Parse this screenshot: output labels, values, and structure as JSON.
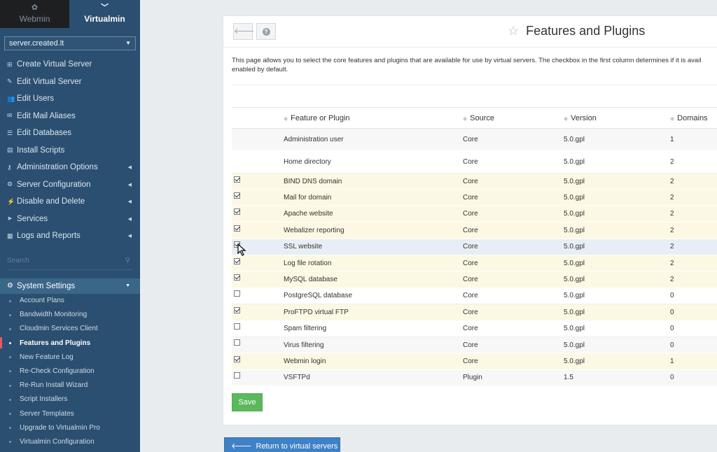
{
  "switcher": {
    "webmin": "Webmin",
    "virtualmin": "Virtualmin"
  },
  "server_select": {
    "value": "server.created.lt"
  },
  "menu": [
    {
      "label": "Create Virtual Server",
      "icon": "plus-square-icon",
      "has_submenu": false
    },
    {
      "label": "Edit Virtual Server",
      "icon": "edit-icon",
      "has_submenu": false
    },
    {
      "label": "Edit Users",
      "icon": "users-icon",
      "has_submenu": false
    },
    {
      "label": "Edit Mail Aliases",
      "icon": "envelope-icon",
      "has_submenu": false
    },
    {
      "label": "Edit Databases",
      "icon": "database-icon",
      "has_submenu": false
    },
    {
      "label": "Install Scripts",
      "icon": "archive-icon",
      "has_submenu": false
    },
    {
      "label": "Administration Options",
      "icon": "key-icon",
      "has_submenu": true
    },
    {
      "label": "Server Configuration",
      "icon": "cogs-icon",
      "has_submenu": true
    },
    {
      "label": "Disable and Delete",
      "icon": "plug-icon",
      "has_submenu": true
    },
    {
      "label": "Services",
      "icon": "paper-plane-icon",
      "has_submenu": true
    },
    {
      "label": "Logs and Reports",
      "icon": "file-icon",
      "has_submenu": true
    }
  ],
  "sidebar_search": {
    "placeholder": "Search"
  },
  "system_settings": {
    "label": "System Settings",
    "items": [
      {
        "label": "Account Plans",
        "active": false
      },
      {
        "label": "Bandwidth Monitoring",
        "active": false
      },
      {
        "label": "Cloudmin Services Client",
        "active": false
      },
      {
        "label": "Features and Plugins",
        "active": true
      },
      {
        "label": "New Feature Log",
        "active": false
      },
      {
        "label": "Re-Check Configuration",
        "active": false
      },
      {
        "label": "Re-Run Install Wizard",
        "active": false
      },
      {
        "label": "Script Installers",
        "active": false
      },
      {
        "label": "Server Templates",
        "active": false
      },
      {
        "label": "Upgrade to Virtualmin Pro",
        "active": false
      },
      {
        "label": "Virtualmin Configuration",
        "active": false
      }
    ]
  },
  "page": {
    "title": "Features and Plugins",
    "description_line1": "This page allows you to select the core features and plugins that are available for use by virtual servers. The checkbox in the first column determines if it is avail",
    "description_line2": "enabled by default."
  },
  "table": {
    "columns": {
      "name": "Feature or Plugin",
      "source": "Source",
      "version": "Version",
      "domains": "Domains"
    },
    "rows": [
      {
        "checkbox": "none",
        "name": "Administration user",
        "source": "Core",
        "version": "5.0.gpl",
        "domains": "1",
        "bg": "grey",
        "tall": true
      },
      {
        "checkbox": "none",
        "name": "Home directory",
        "source": "Core",
        "version": "5.0.gpl",
        "domains": "2",
        "bg": "white",
        "tall": true
      },
      {
        "checkbox": "checked",
        "name": "BIND DNS domain",
        "source": "Core",
        "version": "5.0.gpl",
        "domains": "2",
        "bg": "yellow"
      },
      {
        "checkbox": "checked",
        "name": "Mail for domain",
        "source": "Core",
        "version": "5.0.gpl",
        "domains": "2",
        "bg": "yellow"
      },
      {
        "checkbox": "checked",
        "name": "Apache website",
        "source": "Core",
        "version": "5.0.gpl",
        "domains": "2",
        "bg": "yellow"
      },
      {
        "checkbox": "checked",
        "name": "Webalizer reporting",
        "source": "Core",
        "version": "5.0.gpl",
        "domains": "2",
        "bg": "yellow"
      },
      {
        "checkbox": "checked",
        "name": "SSL website",
        "source": "Core",
        "version": "5.0.gpl",
        "domains": "2",
        "bg": "blue"
      },
      {
        "checkbox": "checked",
        "name": "Log file rotation",
        "source": "Core",
        "version": "5.0.gpl",
        "domains": "2",
        "bg": "yellow"
      },
      {
        "checkbox": "checked",
        "name": "MySQL database",
        "source": "Core",
        "version": "5.0.gpl",
        "domains": "2",
        "bg": "yellow"
      },
      {
        "checkbox": "unchecked",
        "name": "PostgreSQL database",
        "source": "Core",
        "version": "5.0.gpl",
        "domains": "0",
        "bg": "white"
      },
      {
        "checkbox": "checked",
        "name": "ProFTPD virtual FTP",
        "source": "Core",
        "version": "5.0.gpl",
        "domains": "0",
        "bg": "yellow"
      },
      {
        "checkbox": "unchecked",
        "name": "Spam filtering",
        "source": "Core",
        "version": "5.0.gpl",
        "domains": "0",
        "bg": "white"
      },
      {
        "checkbox": "unchecked",
        "name": "Virus filtering",
        "source": "Core",
        "version": "5.0.gpl",
        "domains": "0",
        "bg": "grey"
      },
      {
        "checkbox": "checked",
        "name": "Webmin login",
        "source": "Core",
        "version": "5.0.gpl",
        "domains": "1",
        "bg": "yellow"
      },
      {
        "checkbox": "unchecked",
        "name": "VSFTPd",
        "source": "Plugin",
        "version": "1.5",
        "domains": "0",
        "bg": "grey"
      }
    ]
  },
  "buttons": {
    "save": "Save",
    "return": "Return to virtual servers list"
  },
  "colors": {
    "sidebar": "#2b4f70",
    "save": "#5cb85c",
    "return": "#3f81c6",
    "active_marker": "#e15b64"
  }
}
